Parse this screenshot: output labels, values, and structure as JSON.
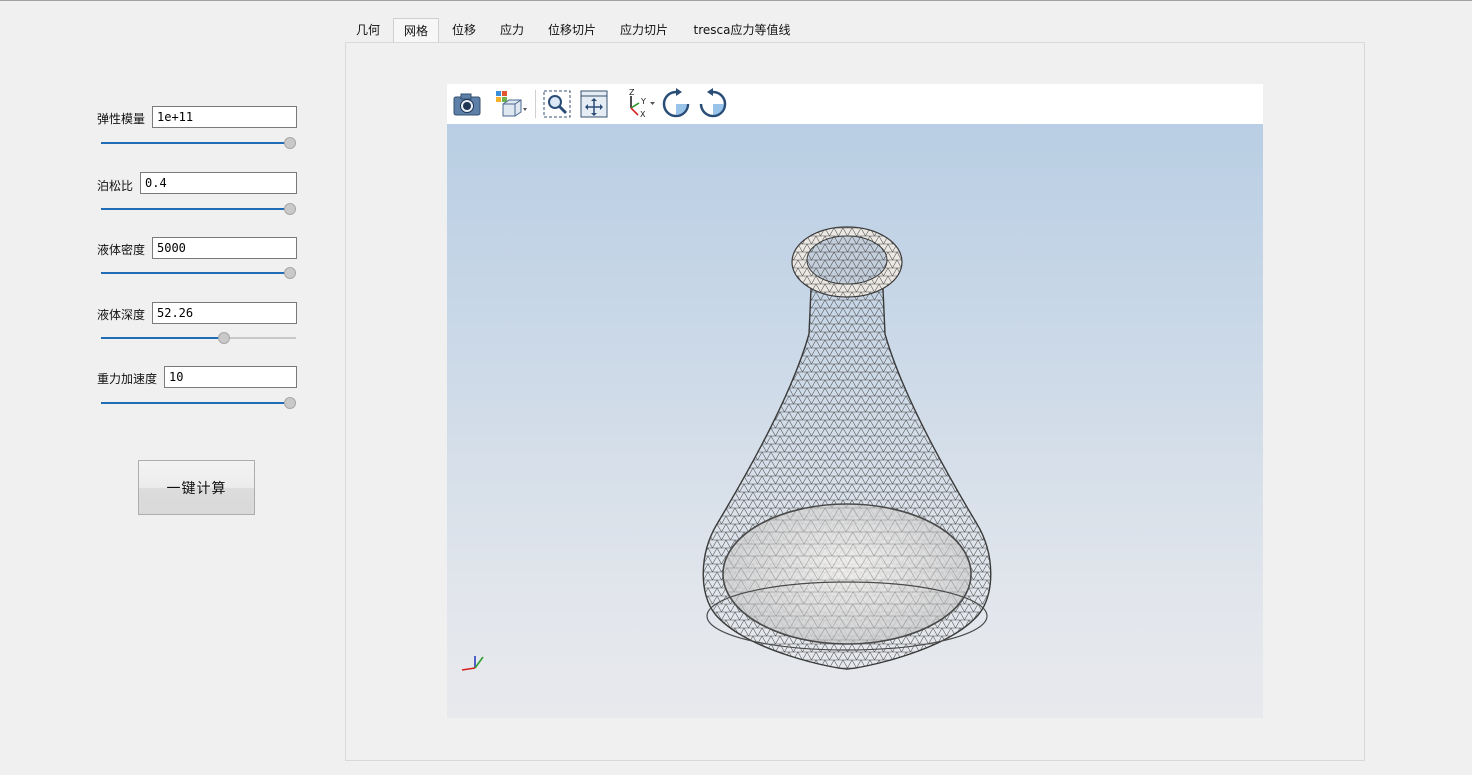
{
  "tabs": [
    {
      "label": "几何"
    },
    {
      "label": "网格"
    },
    {
      "label": "位移"
    },
    {
      "label": "应力"
    },
    {
      "label": "位移切片"
    },
    {
      "label": "应力切片"
    },
    {
      "label": "tresca应力等值线"
    }
  ],
  "active_tab": "网格",
  "params": {
    "elastic_modulus": {
      "label": "弹性模量",
      "value": "1e+11",
      "slider_fraction": 1.0
    },
    "poisson_ratio": {
      "label": "泊松比",
      "value": "0.4",
      "slider_fraction": 1.0
    },
    "liquid_density": {
      "label": "液体密度",
      "value": "5000",
      "slider_fraction": 1.0
    },
    "liquid_depth": {
      "label": "液体深度",
      "value": "52.26",
      "slider_fraction": 0.64
    },
    "gravity": {
      "label": "重力加速度",
      "value": "10",
      "slider_fraction": 1.0
    }
  },
  "calc_button": {
    "label": "一键计算"
  },
  "viewer_toolbar": {
    "icons": [
      "camera-icon",
      "view-cube-icon",
      "zoom-box-icon",
      "fit-view-icon",
      "axes-orientation-icon",
      "rotate-clockwise-icon",
      "rotate-counterclockwise-icon"
    ]
  },
  "orientation_axes": {
    "x": "X",
    "y": "Y",
    "z": "Z"
  },
  "colors": {
    "slider_fill": "#1f6db7",
    "viewport_top": "#b9cee4",
    "viewport_bottom": "#e8e9ed",
    "mesh": "#4b4b4b"
  }
}
